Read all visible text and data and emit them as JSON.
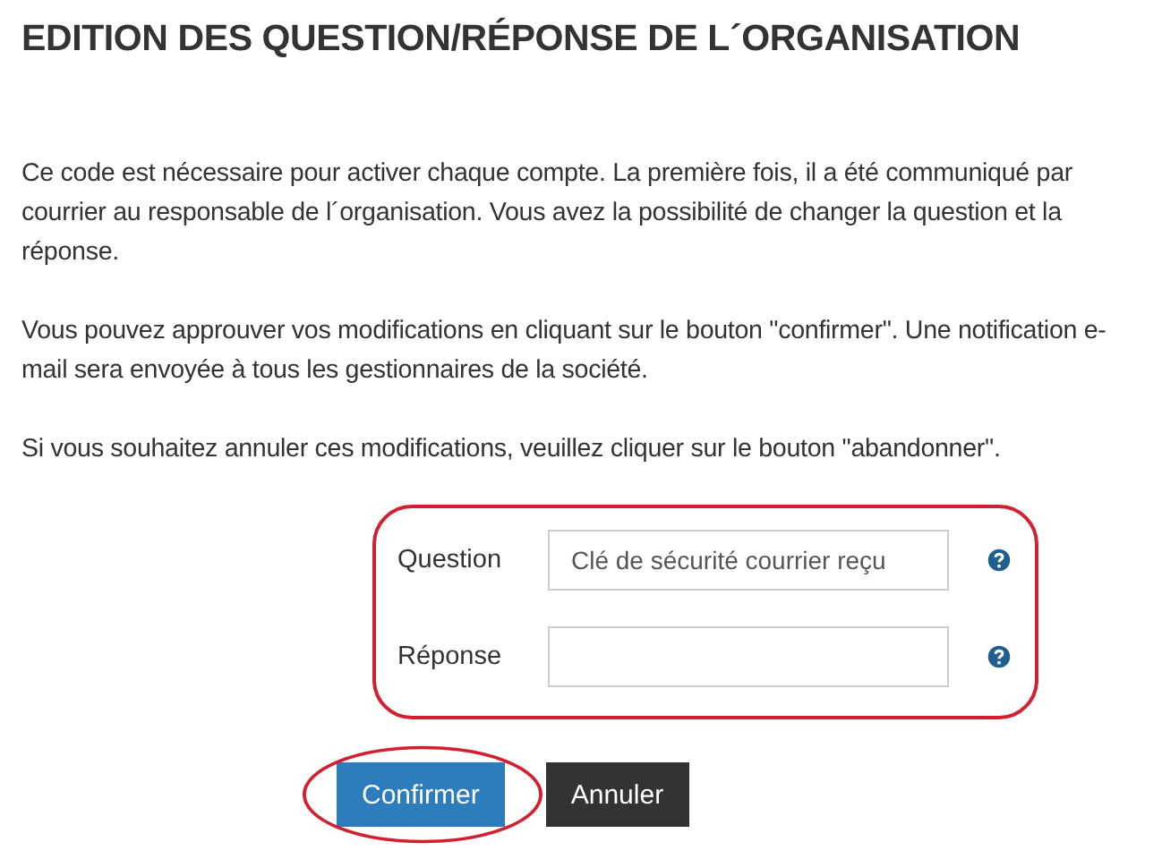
{
  "title": "EDITION DES QUESTION/RÉPONSE DE L´ORGANISATION",
  "paragraphs": [
    "Ce code est nécessaire pour activer chaque compte. La première fois, il a été communiqué par courrier au responsable de l´organisation. Vous avez la possibilité de changer la question et la réponse.",
    "Vous pouvez approuver vos modifications en cliquant sur le bouton \"confirmer\". Une notification e-mail sera envoyée à tous les gestionnaires de la société.",
    "Si vous souhaitez annuler ces modifications, veuillez cliquer sur le bouton \"abandonner\"."
  ],
  "form": {
    "annotated": true,
    "fields": [
      {
        "label": "Question",
        "value": "Clé de sécurité courrier reçu"
      },
      {
        "label": "Réponse"
      }
    ]
  },
  "buttons": [
    {
      "label": "Confirmer",
      "kind": "primary",
      "annotated": true
    },
    {
      "label": "Annuler",
      "kind": "secondary",
      "annotated": false
    }
  ]
}
